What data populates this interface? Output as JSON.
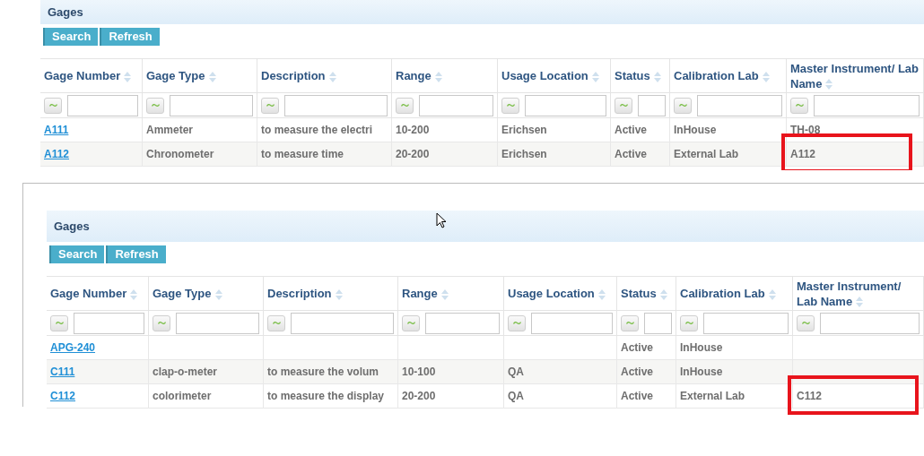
{
  "panels": [
    {
      "title": "Gages",
      "buttons": [
        "Search",
        "Refresh"
      ],
      "columns": [
        "Gage Number",
        "Gage Type",
        "Description",
        "Range",
        "Usage Location",
        "Status",
        "Calibration Lab",
        "Master Instrument/ Lab Name"
      ],
      "rows": [
        {
          "cells": [
            "A111",
            "Ammeter",
            "to measure the electri",
            "10-200",
            "Erichsen",
            "Active",
            "InHouse",
            "TH-08"
          ],
          "marked": false
        },
        {
          "cells": [
            "A112",
            "Chronometer",
            "to measure time",
            "20-200",
            "Erichsen",
            "Active",
            "External Lab",
            "A112"
          ],
          "marked": true
        }
      ]
    },
    {
      "title": "Gages",
      "buttons": [
        "Search",
        "Refresh"
      ],
      "columns": [
        "Gage Number",
        "Gage Type",
        "Description",
        "Range",
        "Usage Location",
        "Status",
        "Calibration Lab",
        "Master Instrument/ Lab Name"
      ],
      "rows": [
        {
          "cells": [
            "APG-240",
            null,
            null,
            null,
            null,
            "Active",
            "InHouse",
            null
          ],
          "marked": false
        },
        {
          "cells": [
            "C111",
            "clap-o-meter",
            "to measure the volum",
            "10-100",
            "QA",
            "Active",
            "InHouse",
            null
          ],
          "marked": false
        },
        {
          "cells": [
            "C112",
            "colorimeter",
            "to measure the display",
            "20-200",
            "QA",
            "Active",
            "External Lab",
            "C112"
          ],
          "marked": true
        }
      ]
    }
  ]
}
